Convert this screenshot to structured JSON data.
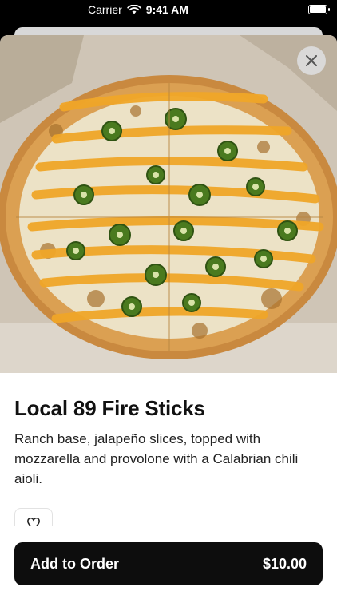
{
  "status_bar": {
    "carrier": "Carrier",
    "time": "9:41 AM"
  },
  "item": {
    "title": "Local 89 Fire Sticks",
    "description": "Ranch base, jalapeño slices, topped with mozzarella and provolone with a Calabrian chili aioli.",
    "image_alt": "Pizza with jalapeño slices and chili aioli"
  },
  "actions": {
    "add_to_order_label": "Add to Order",
    "price": "$10.00"
  },
  "colors": {
    "button_bg": "#0d0d0d",
    "sheet_bg": "#ffffff"
  },
  "icons": {
    "close": "close-icon",
    "favorite": "heart-icon",
    "wifi": "wifi-icon",
    "battery": "battery-icon"
  }
}
